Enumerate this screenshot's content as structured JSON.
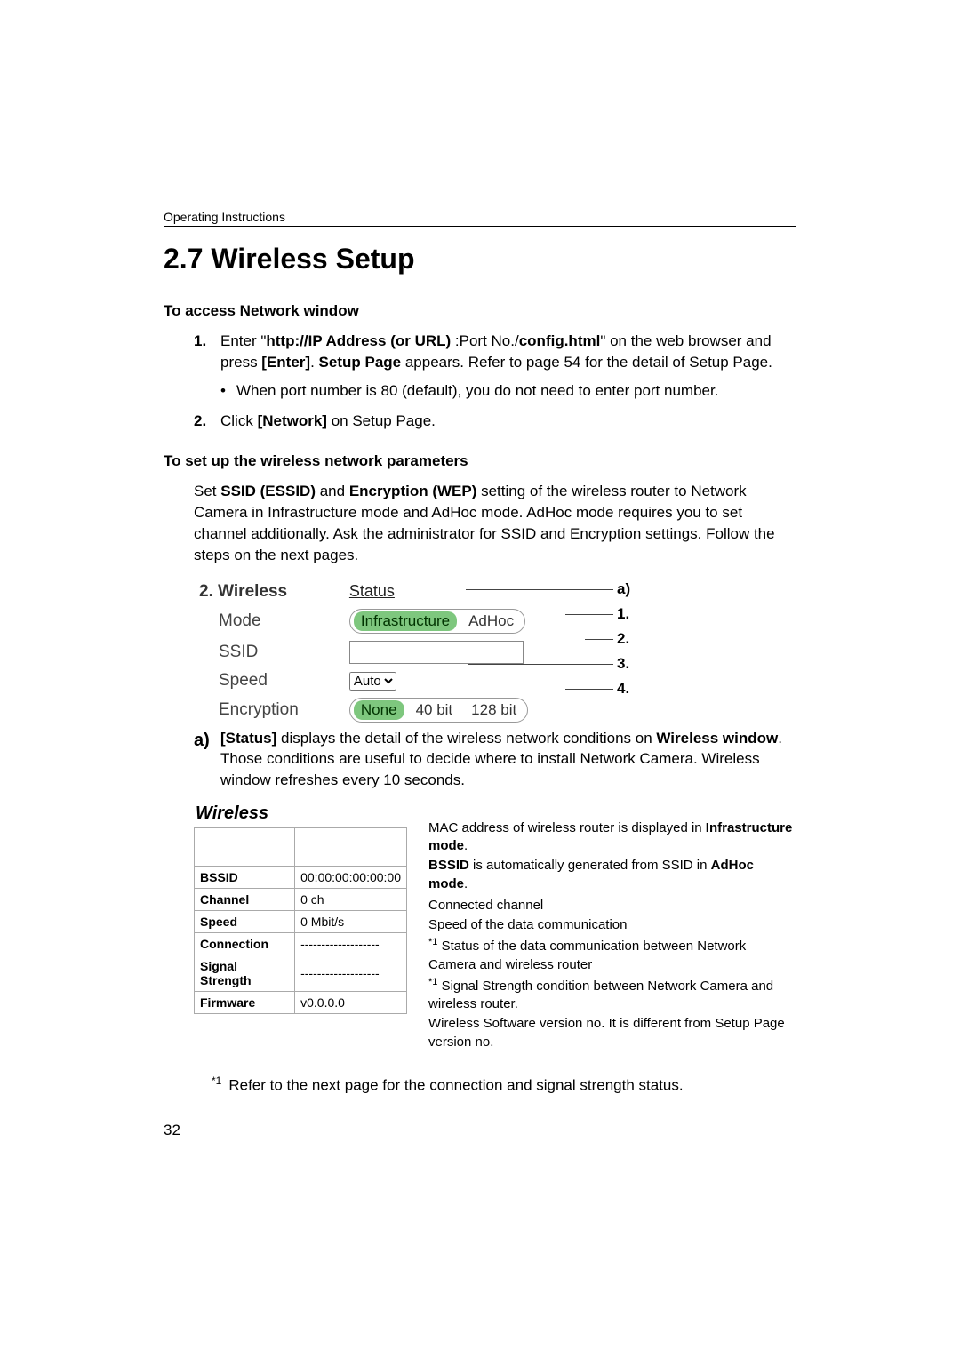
{
  "header": "Operating Instructions",
  "section_title": "2.7   Wireless Setup",
  "access_head": "To access Network window",
  "step1": {
    "num": "1.",
    "pre": "Enter \"",
    "b1": "http://",
    "u1": "IP Address (or URL)",
    "mid": " :Port No./",
    "u2": "config.html",
    "post": "\" on the web browser and press ",
    "b_enter": "[Enter]",
    "post2": ". ",
    "b_sp": "Setup Page",
    "post3": " appears. Refer to page 54 for the detail of Setup Page."
  },
  "bullet1": "When port number is 80 (default), you do not need to enter port number.",
  "step2": {
    "num": "2.",
    "pre": "Click ",
    "b": "[Network]",
    "post": " on Setup Page."
  },
  "params_head": "To set up the wireless network parameters",
  "params_para": {
    "pre": "Set ",
    "b1": "SSID (ESSID)",
    "mid1": " and ",
    "b2": "Encryption (WEP)",
    "post": " setting of the wireless router to Network Camera in Infrastructure mode and AdHoc mode. AdHoc mode requires you to set channel additionally. Ask the administrator for SSID and Encryption settings. Follow the steps on the next pages."
  },
  "form": {
    "title": "2. Wireless",
    "status": "Status",
    "rows": {
      "mode": "Mode",
      "ssid": "SSID",
      "speed": "Speed",
      "encryption": "Encryption"
    },
    "mode_opts": [
      "Infrastructure",
      "AdHoc"
    ],
    "speed_sel": "Auto",
    "enc_opts": [
      "None",
      "40 bit",
      "128 bit"
    ],
    "callouts": [
      "a)",
      "1.",
      "2.",
      "3.",
      "4."
    ]
  },
  "a_block": {
    "lead": "a)",
    "pre": "",
    "b1": "[Status]",
    "t1": " displays the detail of the wireless network conditions on ",
    "b2": "Wireless window",
    "t2": ". Those conditions are useful to decide where to install Network Camera. Wireless window refreshes every 10 seconds."
  },
  "status_table": {
    "title": "Wireless",
    "rows": [
      {
        "k": "BSSID",
        "v": "00:00:00:00:00:00"
      },
      {
        "k": "Channel",
        "v": "0 ch"
      },
      {
        "k": "Speed",
        "v": "0 Mbit/s"
      },
      {
        "k": "Connection",
        "v": "-------------------"
      },
      {
        "k": "Signal Strength",
        "v": "-------------------"
      },
      {
        "k": "Firmware",
        "v": "v0.0.0.0"
      }
    ]
  },
  "explain": {
    "e1a": "MAC address of wireless router is displayed in ",
    "e1b": "Infrastructure mode",
    "e1c": ". ",
    "e1d": "BSSID",
    "e1e": " is automatically generated from SSID in ",
    "e1f": "AdHoc mode",
    "e1g": ".",
    "e2": "Connected channel",
    "e3": "Speed of the data communication",
    "e4": " Status of the data communication between Network Camera and wireless router",
    "e5": " Signal Strength condition between Network Camera and wireless router.",
    "e6": "Wireless Software version no.  It is different from Setup Page version no."
  },
  "footnote": "Refer to the next page for the connection and signal strength status.",
  "footnote_mark": "*1",
  "page_number": "32",
  "star": "*1"
}
